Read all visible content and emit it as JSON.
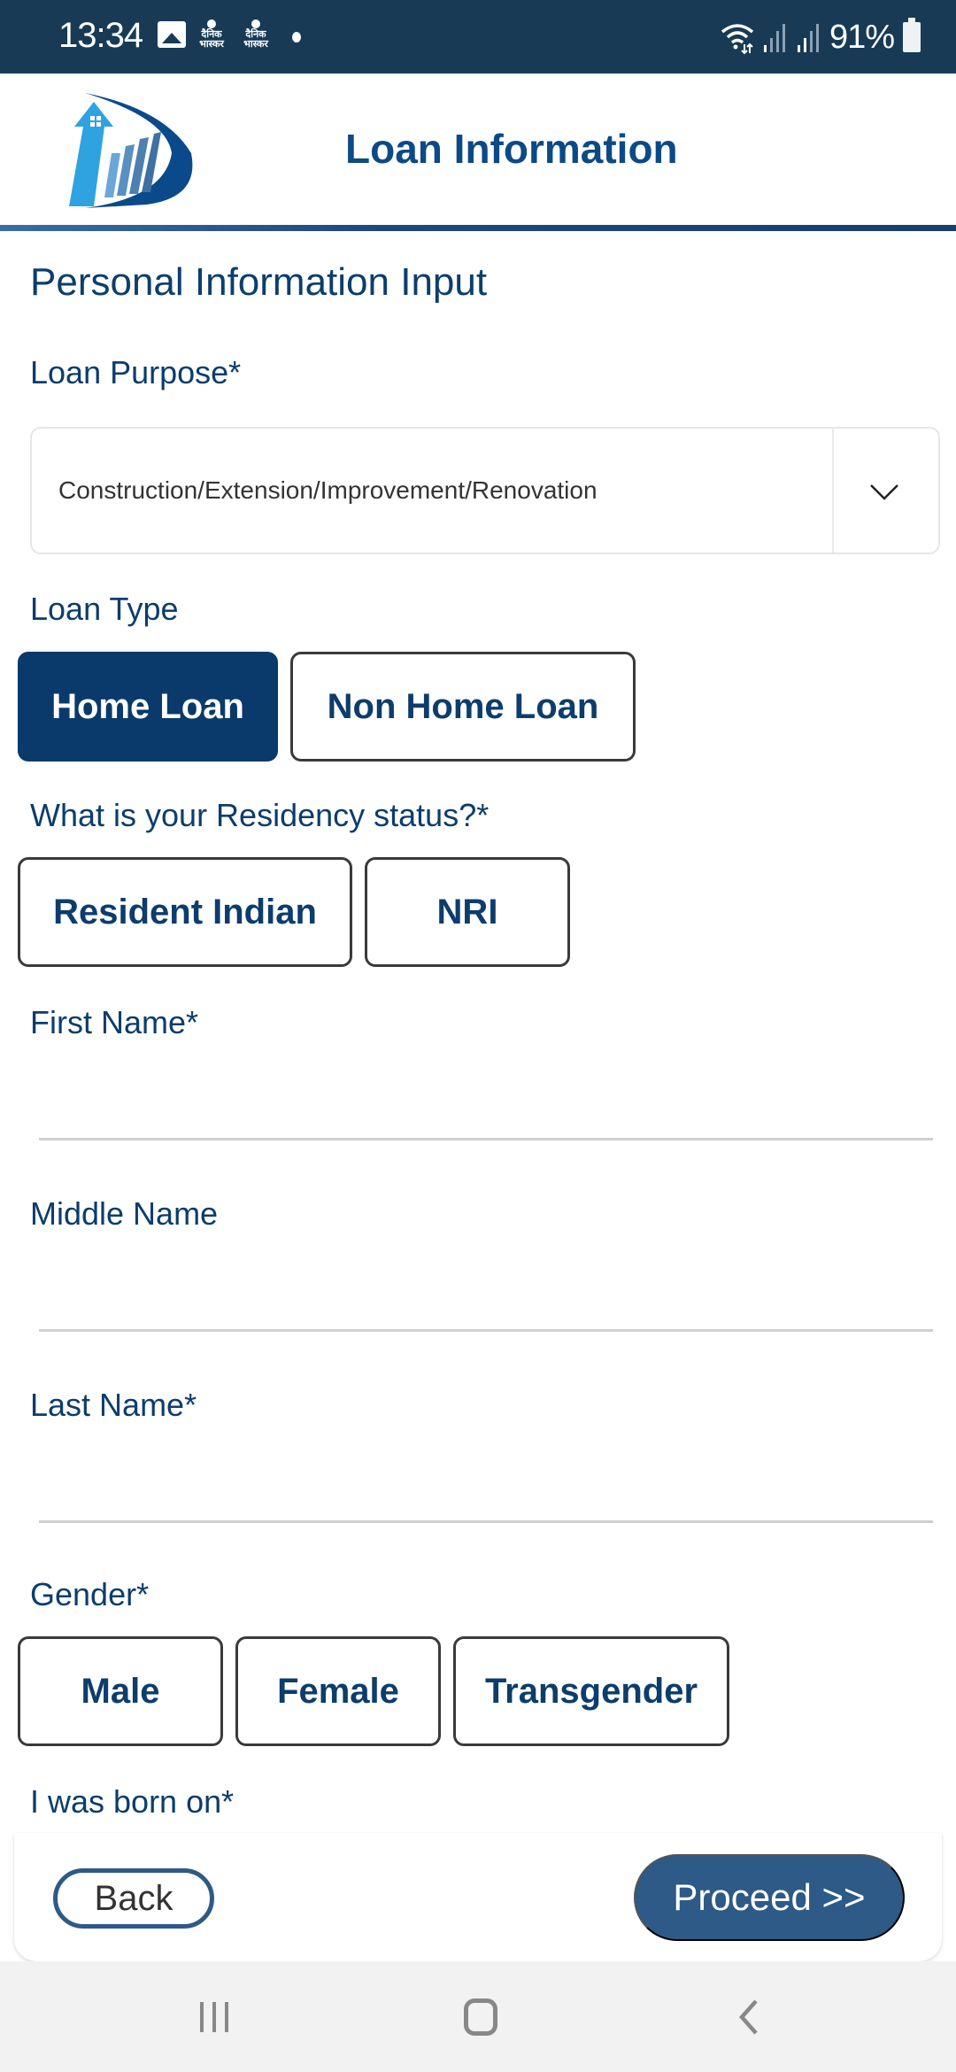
{
  "status_bar": {
    "time": "13:34",
    "notification_icons": [
      "image-icon",
      "dainik-bhaskar-icon",
      "dainik-bhaskar-icon",
      "dot-icon"
    ],
    "news_icon_text_top": "दैनिक",
    "news_icon_text_bottom": "भास्कर",
    "battery_percent": "91%"
  },
  "header": {
    "title": "Loan Information"
  },
  "form": {
    "section_title": "Personal Information Input",
    "loan_purpose": {
      "label": "Loan Purpose*",
      "selected_value": "Construction/Extension/Improvement/Renovation"
    },
    "loan_type": {
      "label": "Loan Type",
      "options": [
        {
          "label": "Home Loan",
          "selected": true
        },
        {
          "label": "Non Home Loan",
          "selected": false
        }
      ]
    },
    "residency": {
      "label": "What is your Residency status?*",
      "options": [
        {
          "label": "Resident Indian",
          "selected": false
        },
        {
          "label": "NRI",
          "selected": false
        }
      ]
    },
    "first_name": {
      "label": "First Name*",
      "value": ""
    },
    "middle_name": {
      "label": "Middle Name",
      "value": ""
    },
    "last_name": {
      "label": "Last Name*",
      "value": ""
    },
    "gender": {
      "label": "Gender*",
      "options": [
        {
          "label": "Male",
          "selected": false
        },
        {
          "label": "Female",
          "selected": false
        },
        {
          "label": "Transgender",
          "selected": false
        }
      ]
    },
    "dob": {
      "label": "I was born on*"
    }
  },
  "footer": {
    "back_label": "Back",
    "proceed_label": "Proceed >>"
  },
  "colors": {
    "primary": "#0a3a6b",
    "button": "#2d5a86",
    "status_bar": "#183a55"
  }
}
